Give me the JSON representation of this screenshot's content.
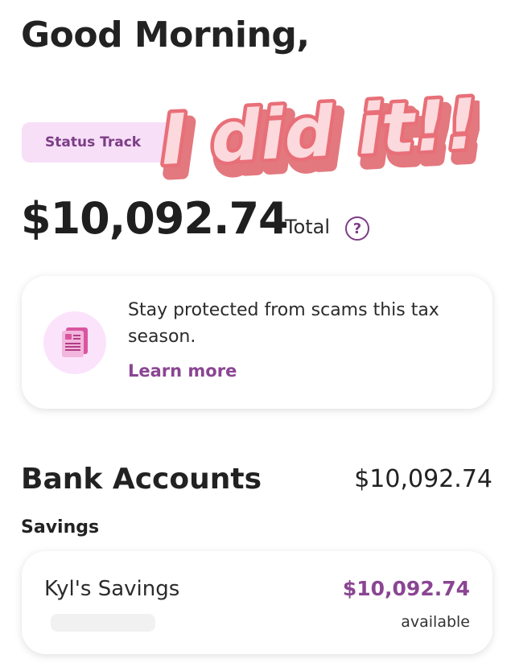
{
  "greeting": "Good Morning,",
  "status_pill": "Status Track",
  "sticker_text": "I did it!!!",
  "total": {
    "amount": "$10,092.74",
    "label": "Total",
    "help_glyph": "?"
  },
  "promo": {
    "text": "Stay protected from scams this tax season.",
    "link": "Learn more",
    "icon": "document-icon"
  },
  "bank_accounts": {
    "heading": "Bank Accounts",
    "total": "$10,092.74",
    "section": "Savings",
    "accounts": [
      {
        "name": "Kyl's Savings",
        "amount": "$10,092.74",
        "status": "available"
      }
    ]
  },
  "colors": {
    "accent": "#8a4593",
    "pill_bg": "#f6dff7",
    "icon_bg": "#fbe3fb",
    "sticker_fill": "#fbd0d4",
    "sticker_shadow": "#e3787e"
  }
}
